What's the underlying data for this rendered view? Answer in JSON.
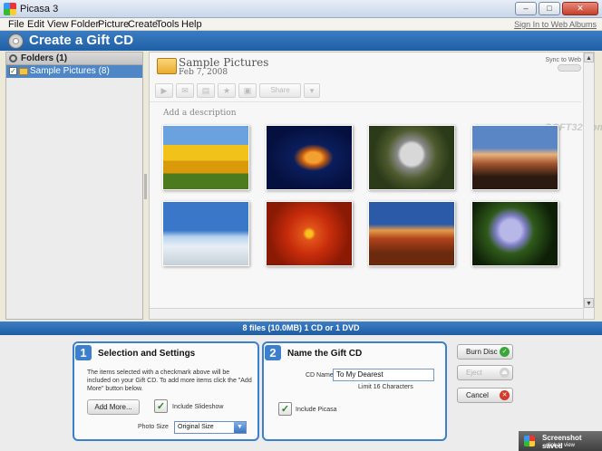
{
  "window": {
    "title": "Picasa 3",
    "min": "–",
    "max": "□",
    "close": "✕"
  },
  "menu": {
    "items": [
      "File",
      "Edit",
      "View",
      "Folder",
      "Picture",
      "Create",
      "Tools",
      "Help"
    ],
    "signin": "Sign In to Web Albums"
  },
  "header": {
    "title": "Create a Gift CD"
  },
  "sidebar": {
    "heading": "Folders (1)",
    "items": [
      {
        "label": "Sample Pictures (8)",
        "checked": true
      }
    ]
  },
  "album": {
    "title": "Sample Pictures",
    "date": "Feb 7, 2008",
    "sync_label": "Sync to Web",
    "share_label": "Share",
    "description_placeholder": "Add a description",
    "watermark": "SOFT32.com",
    "photos": [
      "tulips-photo",
      "jellyfish-photo",
      "koala-photo",
      "lighthouse-photo",
      "penguins-photo",
      "chrysanthemum-photo",
      "desert-photo",
      "hydrangeas-photo"
    ]
  },
  "status": {
    "summary": "8 files (10.0MB) 1 CD or 1 DVD"
  },
  "panel1": {
    "number": "1",
    "title": "Selection and Settings",
    "description": "The items selected with a checkmark above will be included on your Gift CD.  To add more items click the \"Add More\" button below.",
    "add_more_label": "Add More...",
    "include_slideshow_label": "Include Slideshow",
    "photo_size_label": "Photo Size",
    "photo_size_value": "Original Size"
  },
  "panel2": {
    "number": "2",
    "title": "Name the Gift CD",
    "cd_name_label": "CD Name",
    "cd_name_value": "To My Dearest",
    "limit_text": "Limit 16 Characters",
    "include_picasa_label": "Include Picasa"
  },
  "actions": {
    "burn_label": "Burn Disc",
    "eject_label": "Eject",
    "cancel_label": "Cancel"
  },
  "toast": {
    "title": "Screenshot saved",
    "subtitle": "click to view"
  },
  "colors": {
    "accent": "#3c7fcc",
    "header": "#1f5fa5",
    "selection": "#4f86c5"
  }
}
